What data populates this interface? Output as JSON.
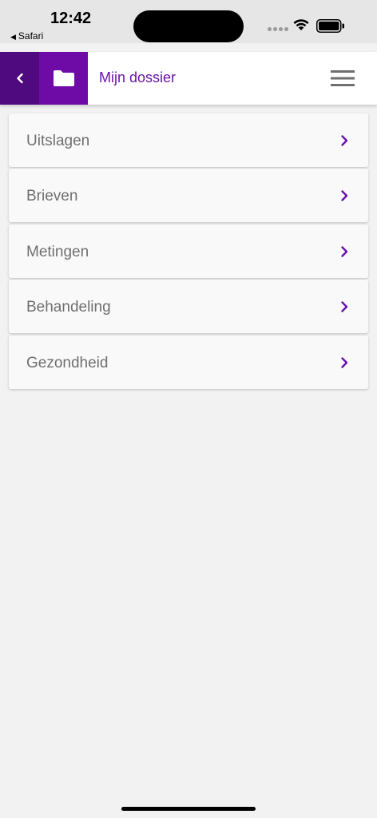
{
  "status_bar": {
    "time": "12:42",
    "back_app": "Safari"
  },
  "header": {
    "title": "Mijn dossier"
  },
  "menu_items": [
    {
      "label": "Uitslagen"
    },
    {
      "label": "Brieven"
    },
    {
      "label": "Metingen"
    },
    {
      "label": "Behandeling"
    },
    {
      "label": "Gezondheid"
    }
  ],
  "colors": {
    "accent": "#6a12a8",
    "back_button": "#4e0a7e",
    "folder_box": "#6e0aa6",
    "background": "#f2f2f2"
  },
  "icons": {
    "back": "chevron-left-icon",
    "folder": "folder-icon",
    "menu": "hamburger-menu-icon",
    "item": "chevron-right-icon"
  }
}
